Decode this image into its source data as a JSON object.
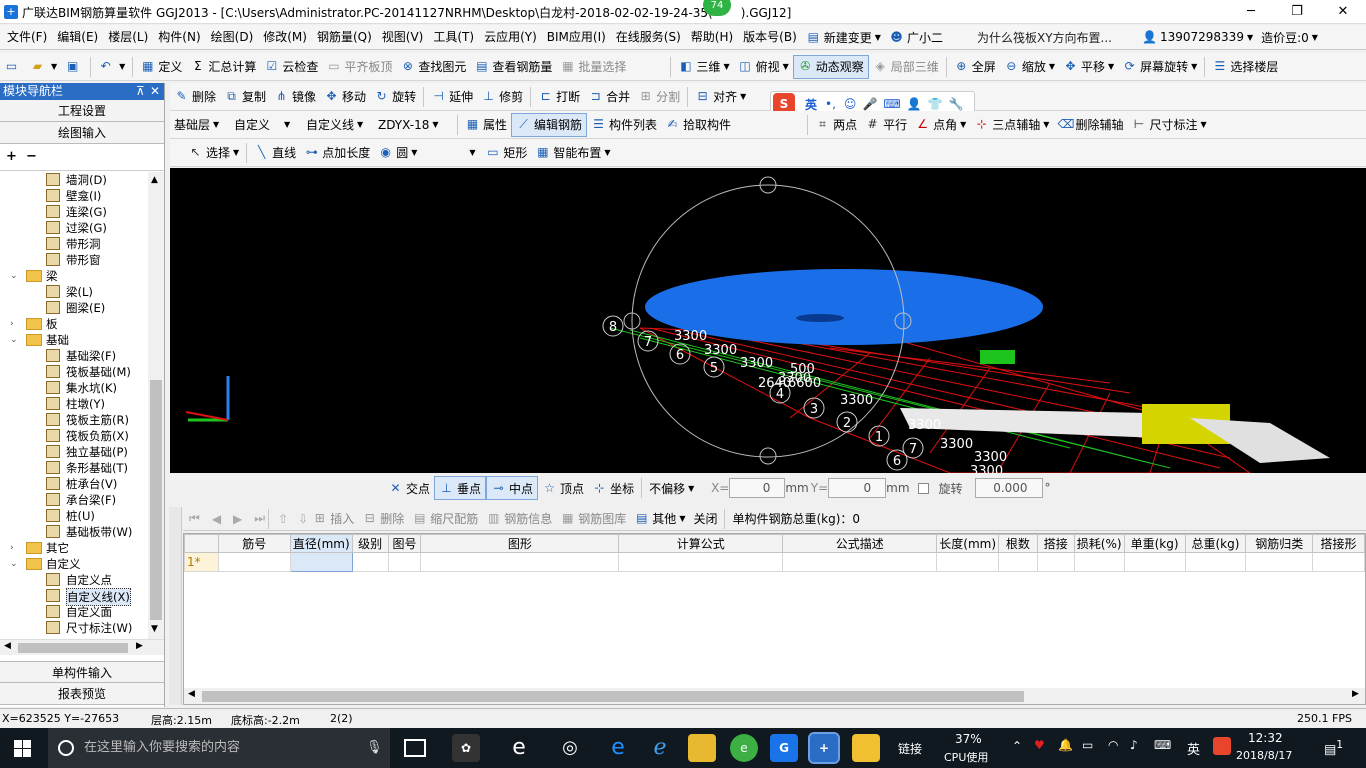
{
  "title": {
    "text": "广联达BIM钢筋算量软件 GGJ2013 - [C:\\Users\\Administrator.PC-20141127NRHM\\Desktop\\白龙村-2018-02-02-19-24-35(",
    "text_suffix": ").GGJ12]",
    "badge": "74",
    "minimize": "─",
    "maximize": "❐",
    "close": "✕"
  },
  "menubar": {
    "items": [
      "文件(F)",
      "编辑(E)",
      "楼层(L)",
      "构件(N)",
      "绘图(D)",
      "修改(M)",
      "钢筋量(Q)",
      "视图(V)",
      "工具(T)",
      "云应用(Y)",
      "BIM应用(I)",
      "在线服务(S)",
      "帮助(H)",
      "版本号(B)"
    ],
    "new_change": "新建变更",
    "assistant": "广小二",
    "question": "为什么筏板XY方向布置...",
    "phone": "13907298339",
    "beans": "造价豆:0"
  },
  "toolbar1": {
    "define": "定义",
    "calc": "汇总计算",
    "cloud_check": "云检查",
    "flat_board": "平齐板顶",
    "find": "查找图元",
    "view_rebar": "查看钢筋量",
    "batch_select": "批量选择",
    "three_d": "三维",
    "top_view": "俯视",
    "dynamic": "动态观察",
    "local_3d": "局部三维",
    "fullscreen": "全屏",
    "zoom": "缩放",
    "pan": "平移",
    "rotate_screen": "屏幕旋转",
    "select_floor": "选择楼层"
  },
  "toolbar2": {
    "delete": "删除",
    "copy": "复制",
    "mirror": "镜像",
    "move": "移动",
    "rotate": "旋转",
    "extend": "延伸",
    "trim": "修剪",
    "break": "打断",
    "merge": "合并",
    "split": "分割",
    "align": "对齐"
  },
  "toolbar3": {
    "layer": "基础层",
    "custom": "自定义",
    "custom_line": "自定义线",
    "code": "ZDYX-18",
    "props": "属性",
    "edit_rebar": "编辑钢筋",
    "comp_list": "构件列表",
    "pick": "拾取构件",
    "two_point": "两点",
    "parallel": "平行",
    "point_angle": "点角",
    "three_axis": "三点辅轴",
    "del_axis": "删除辅轴",
    "dim": "尺寸标注"
  },
  "toolbar4": {
    "select": "选择",
    "line": "直线",
    "point_len": "点加长度",
    "circle": "圆",
    "rect": "矩形",
    "smart": "智能布置"
  },
  "sogou": {
    "logo": "S",
    "lang": "英",
    "punct": "•,",
    "face": "☺",
    "mic": "🎤",
    "keyboard": "⌨",
    "person": "👤",
    "shirt": "👕",
    "tool": "🔧"
  },
  "nav": {
    "header": "模块导航栏",
    "pin": "⊼",
    "close": "✕",
    "project_settings": "工程设置",
    "drawing_input": "绘图输入",
    "single_input": "单构件输入",
    "report": "报表预览",
    "tree": [
      {
        "label": "墙洞(D)",
        "level": 2
      },
      {
        "label": "壁龛(I)",
        "level": 2
      },
      {
        "label": "连梁(G)",
        "level": 2
      },
      {
        "label": "过梁(G)",
        "level": 2
      },
      {
        "label": "带形洞",
        "level": 2
      },
      {
        "label": "带形窗",
        "level": 2
      },
      {
        "label": "梁",
        "level": 1,
        "exp": "⌄"
      },
      {
        "label": "梁(L)",
        "level": 2
      },
      {
        "label": "圈梁(E)",
        "level": 2
      },
      {
        "label": "板",
        "level": 1,
        "exp": "›"
      },
      {
        "label": "基础",
        "level": 1,
        "exp": "⌄"
      },
      {
        "label": "基础梁(F)",
        "level": 2
      },
      {
        "label": "筏板基础(M)",
        "level": 2
      },
      {
        "label": "集水坑(K)",
        "level": 2
      },
      {
        "label": "柱墩(Y)",
        "level": 2
      },
      {
        "label": "筏板主筋(R)",
        "level": 2
      },
      {
        "label": "筏板负筋(X)",
        "level": 2
      },
      {
        "label": "独立基础(P)",
        "level": 2
      },
      {
        "label": "条形基础(T)",
        "level": 2
      },
      {
        "label": "桩承台(V)",
        "level": 2
      },
      {
        "label": "承台梁(F)",
        "level": 2
      },
      {
        "label": "桩(U)",
        "level": 2
      },
      {
        "label": "基础板带(W)",
        "level": 2
      },
      {
        "label": "其它",
        "level": 1,
        "exp": "›"
      },
      {
        "label": "自定义",
        "level": 1,
        "exp": "⌄"
      },
      {
        "label": "自定义点",
        "level": 2
      },
      {
        "label": "自定义线(X)",
        "level": 2,
        "selected": true
      },
      {
        "label": "自定义面",
        "level": 2
      },
      {
        "label": "尺寸标注(W)",
        "level": 2
      }
    ]
  },
  "canvas": {
    "labels": [
      "3300",
      "3300",
      "3300",
      "3300",
      "2640",
      "6600",
      "3300",
      "3300",
      "3300",
      "3300",
      "3300",
      "500"
    ],
    "circle_nums": [
      "8",
      "7",
      "6",
      "5",
      "4",
      "3",
      "2",
      "1",
      "7",
      "6"
    ]
  },
  "snap": {
    "intersect": "交点",
    "perpendicular": "垂点",
    "midpoint": "中点",
    "vertex": "顶点",
    "coord": "坐标",
    "offset": "不偏移",
    "x_label": "X=",
    "x_val": "0",
    "mm1": "mm",
    "y_label": "Y=",
    "y_val": "0",
    "mm2": "mm",
    "rotate": "旋转",
    "rot_val": "0.000",
    "deg": "°"
  },
  "gridtb": {
    "insert": "插入",
    "delete": "删除",
    "scale": "缩尺配筋",
    "info": "钢筋信息",
    "library": "钢筋图库",
    "other": "其他",
    "close": "关闭",
    "total": "单构件钢筋总重(kg)：0"
  },
  "grid": {
    "headers": [
      "",
      "筋号",
      "直径(mm)",
      "级别",
      "图号",
      "图形",
      "计算公式",
      "公式描述",
      "长度(mm)",
      "根数",
      "搭接",
      "损耗(%)",
      "单重(kg)",
      "总重(kg)",
      "钢筋归类",
      "搭接形"
    ],
    "row1": "1*"
  },
  "status": {
    "coords": "X=623525 Y=-27653",
    "floor_h": "层高:2.15m",
    "base_h": "底标高:-2.2m",
    "count": "2(2)",
    "fps": "250.1 FPS"
  },
  "taskbar": {
    "search": "在这里输入你要搜索的内容",
    "link": "链接",
    "cpu_pct": "37%",
    "cpu": "CPU使用",
    "lang": "英",
    "time": "12:32",
    "date": "2018/8/17",
    "notif": "1"
  }
}
